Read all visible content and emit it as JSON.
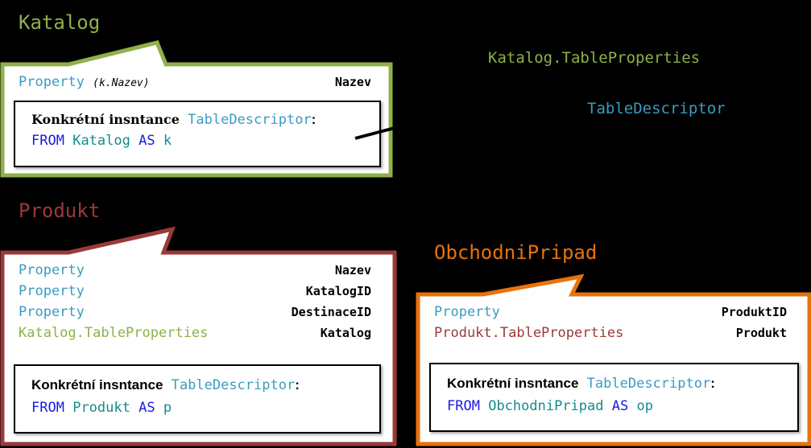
{
  "colors": {
    "background": "#000000",
    "katalog": "#8fb04a",
    "produkt": "#9b3a38",
    "obchodni": "#e8720c",
    "type_blue": "#3a9bbf",
    "keyword": "#1a1ae6",
    "identifier": "#138c8c"
  },
  "floating_labels": {
    "katalog_table_properties": "Katalog.TableProperties",
    "table_descriptor": "TableDescriptor"
  },
  "entities": [
    {
      "title": "Katalog",
      "properties": [
        {
          "type": "Property",
          "note": "(k.Nazev)",
          "name": "Nazev"
        }
      ],
      "instance": {
        "label": "Konkrétní insntance",
        "type": "TableDescriptor",
        "colon": ":",
        "from_kw": "FROM",
        "table": "Katalog",
        "as_kw": "AS",
        "alias": "k"
      }
    },
    {
      "title": "Produkt",
      "properties": [
        {
          "type": "Property",
          "name": "Nazev"
        },
        {
          "type": "Property",
          "name": "KatalogID"
        },
        {
          "type": "Property",
          "name": "DestinaceID"
        },
        {
          "type": "Katalog.TableProperties",
          "name": "Katalog"
        }
      ],
      "instance": {
        "label": "Konkrétní insntance",
        "type": "TableDescriptor",
        "colon": ":",
        "from_kw": "FROM",
        "table": "Produkt",
        "as_kw": "AS",
        "alias": "p"
      }
    },
    {
      "title": "ObchodniPripad",
      "properties": [
        {
          "type": "Property",
          "name": "ProduktID"
        },
        {
          "type": "Produkt.TableProperties",
          "name": "Produkt"
        }
      ],
      "instance": {
        "label": "Konkrétní insntance",
        "type": "TableDescriptor",
        "colon": ":",
        "from_kw": "FROM",
        "table": "ObchodniPripad",
        "as_kw": "AS",
        "alias": "op"
      }
    }
  ]
}
